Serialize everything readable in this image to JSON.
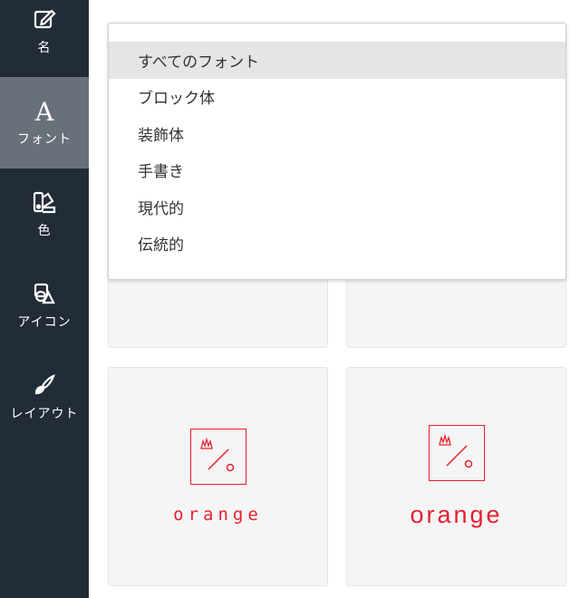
{
  "sidebar": {
    "items": [
      {
        "label": "名",
        "icon": "edit-icon",
        "active": false
      },
      {
        "label": "フォント",
        "icon": "font-icon",
        "active": true
      },
      {
        "label": "色",
        "icon": "palette-icon",
        "active": false
      },
      {
        "label": "アイコン",
        "icon": "shapes-icon",
        "active": false
      },
      {
        "label": "レイアウト",
        "icon": "brush-icon",
        "active": false
      }
    ]
  },
  "font_dropdown": {
    "options": [
      "すべてのフォント",
      "ブロック体",
      "装飾体",
      "手書き",
      "現代的",
      "伝統的"
    ],
    "selected": "すべてのフォント"
  },
  "cards": [
    {
      "brand": "orange",
      "style": "thin"
    },
    {
      "brand": "orange",
      "style": "bold"
    }
  ],
  "colors": {
    "sidebar_bg": "#222c37",
    "sidebar_active": "#68717a",
    "brand_red": "#e8202f",
    "card_bg": "#f5f5f5"
  }
}
